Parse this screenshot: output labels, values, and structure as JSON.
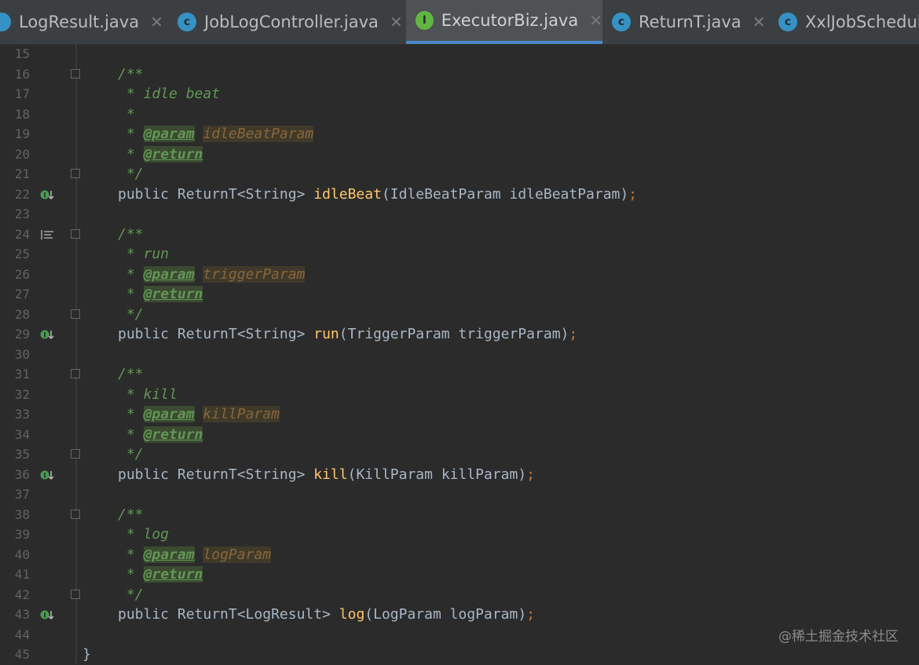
{
  "tabs": [
    {
      "label": "LogResult.java",
      "icon": "class-icon",
      "icon_letter": "",
      "icon_color": "#3592c4",
      "active": false
    },
    {
      "label": "JobLogController.java",
      "icon": "class-icon",
      "icon_letter": "c",
      "icon_color": "#3592c4",
      "active": false
    },
    {
      "label": "ExecutorBiz.java",
      "icon": "interface-icon",
      "icon_letter": "I",
      "icon_color": "#62b543",
      "active": true
    },
    {
      "label": "ReturnT.java",
      "icon": "class-icon",
      "icon_letter": "c",
      "icon_color": "#3592c4",
      "active": false
    },
    {
      "label": "XxlJobSchedul",
      "icon": "class-icon",
      "icon_letter": "c",
      "icon_color": "#3592c4",
      "active": false
    }
  ],
  "lines": [
    {
      "n": "15",
      "text": ""
    },
    {
      "n": "16",
      "text": "/**"
    },
    {
      "n": "17",
      "text": " * idle beat"
    },
    {
      "n": "18",
      "text": " *"
    },
    {
      "n": "19",
      "text": " * @param idleBeatParam"
    },
    {
      "n": "20",
      "text": " * @return"
    },
    {
      "n": "21",
      "text": " */"
    },
    {
      "n": "22",
      "text": "public ReturnT<String> idleBeat(IdleBeatParam idleBeatParam);"
    },
    {
      "n": "23",
      "text": ""
    },
    {
      "n": "24",
      "text": "/**"
    },
    {
      "n": "25",
      "text": " * run"
    },
    {
      "n": "26",
      "text": " * @param triggerParam"
    },
    {
      "n": "27",
      "text": " * @return"
    },
    {
      "n": "28",
      "text": " */"
    },
    {
      "n": "29",
      "text": "public ReturnT<String> run(TriggerParam triggerParam);"
    },
    {
      "n": "30",
      "text": ""
    },
    {
      "n": "31",
      "text": "/**"
    },
    {
      "n": "32",
      "text": " * kill"
    },
    {
      "n": "33",
      "text": " * @param killParam"
    },
    {
      "n": "34",
      "text": " * @return"
    },
    {
      "n": "35",
      "text": " */"
    },
    {
      "n": "36",
      "text": "public ReturnT<String> kill(KillParam killParam);"
    },
    {
      "n": "37",
      "text": ""
    },
    {
      "n": "38",
      "text": "/**"
    },
    {
      "n": "39",
      "text": " * log"
    },
    {
      "n": "40",
      "text": " * @param logParam"
    },
    {
      "n": "41",
      "text": " * @return"
    },
    {
      "n": "42",
      "text": " */"
    },
    {
      "n": "43",
      "text": "public ReturnT<LogResult> log(LogParam logParam);"
    },
    {
      "n": "44",
      "text": ""
    },
    {
      "n": "45",
      "text": "}"
    }
  ],
  "watermark": "@稀土掘金技术社区",
  "colors": {
    "background": "#2b2b2b",
    "comment": "#629755",
    "method": "#ffc66d",
    "keyword": "#a9b7c6",
    "tab_active_underline": "#4a88c7"
  }
}
